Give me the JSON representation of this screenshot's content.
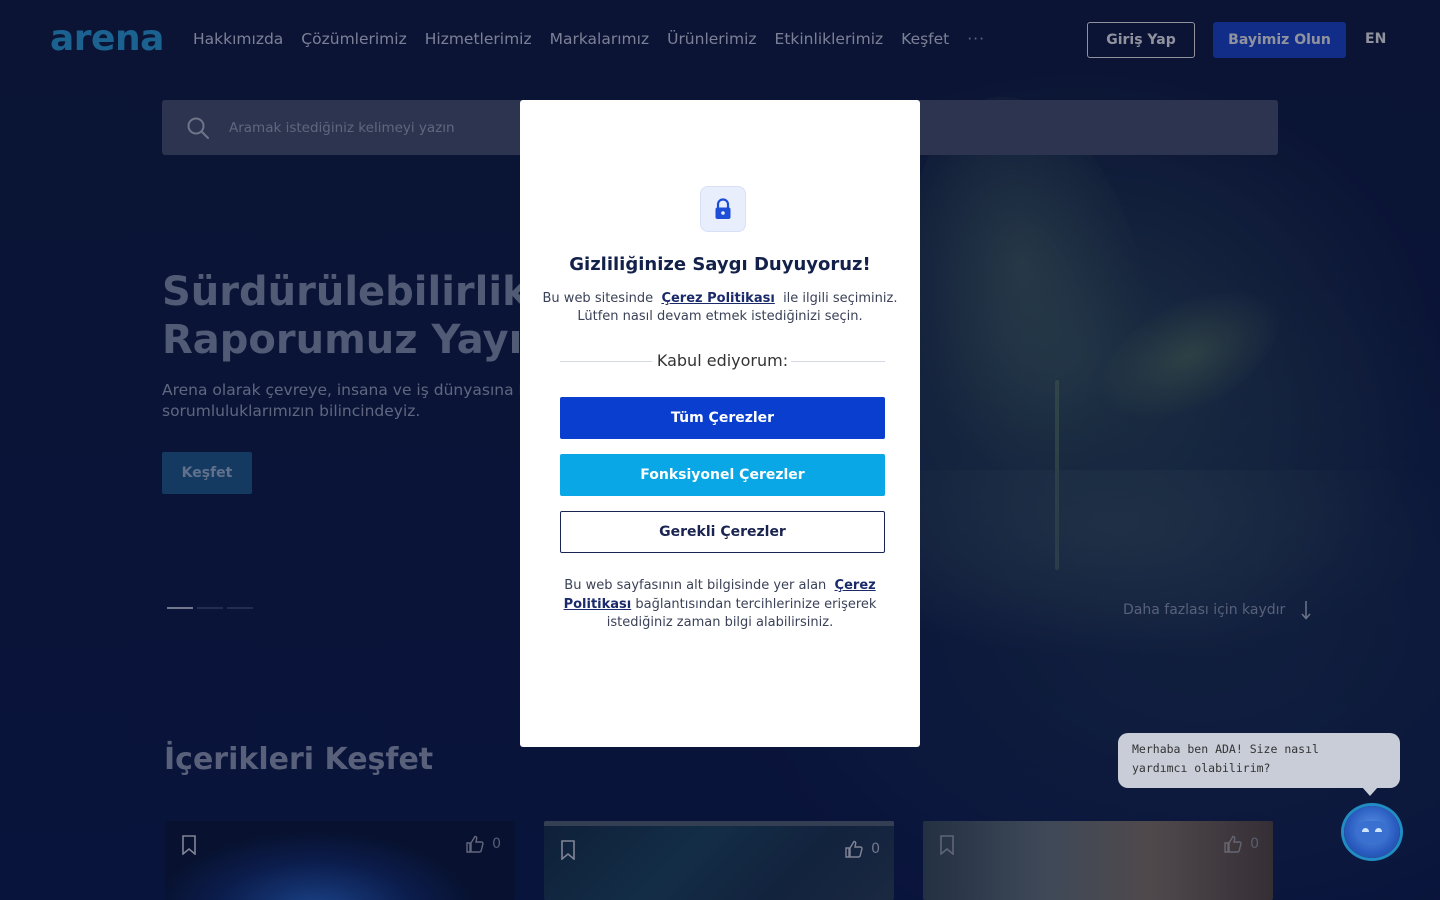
{
  "header": {
    "logo": "arena",
    "nav": [
      "Hakkımızda",
      "Çözümlerimiz",
      "Hizmetlerimiz",
      "Markalarımız",
      "Ürünlerimiz",
      "Etkinliklerimiz",
      "Keşfet"
    ],
    "more": "···",
    "login": "Giriş Yap",
    "dealer": "Bayimiz Olun",
    "lang": "EN"
  },
  "search": {
    "placeholder": "Aramak istediğiniz kelimeyi yazın"
  },
  "hero": {
    "title_line1": "Sürdürülebilirlik",
    "title_line2": "Raporumuz Yayınd",
    "desc_line1": "Arena olarak çevreye, insana ve iş dünyasına karşı",
    "desc_line2": "sorumluluklarımızın bilincindeyiz.",
    "cta": "Keşfet",
    "scroll_hint": "Daha fazlası için kaydır"
  },
  "discover": {
    "title": "İçerikleri Keşfet",
    "cards": [
      {
        "likes": "0"
      },
      {
        "likes": "0"
      },
      {
        "likes": "0"
      }
    ]
  },
  "cookie_modal": {
    "title": "Gizliliğinize Saygı Duyuyoruz!",
    "text_pre": "Bu web sitesinde",
    "policy_link": "Çerez Politikası",
    "text_post": "ile ilgili seçiminiz.",
    "text_line2": "Lütfen nasıl devam etmek istediğinizi seçin.",
    "accept_label": "Kabul ediyorum:",
    "btn_all": "Tüm Çerezler",
    "btn_functional": "Fonksiyonel Çerezler",
    "btn_required": "Gerekli Çerezler",
    "footer_pre": "Bu web sayfasının alt bilgisinde yer alan",
    "footer_link": "Çerez Politikası",
    "footer_post": "bağlantısından tercihlerinize erişerek istediğiniz zaman bilgi alabilirsiniz."
  },
  "chat": {
    "line1": "Merhaba ben ADA! Size nasıl",
    "line2": "yardımcı olabilirim?"
  },
  "colors": {
    "primary": "#0a3ecf",
    "functional": "#0aa7e6",
    "dealer": "#1848d8",
    "logo": "#2aa8e6"
  }
}
